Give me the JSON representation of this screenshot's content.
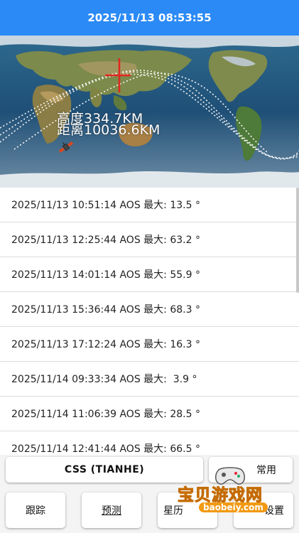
{
  "header": {
    "datetime": "2025/11/13 08:53:55"
  },
  "map": {
    "altitude": "高度334.7KM",
    "distance": "距离10036.6KM",
    "satellite_icon": "satellite-icon",
    "location_marker": "crosshair-icon"
  },
  "passes": [
    {
      "text": "2025/11/13 10:51:14 AOS 最大: 13.5 °"
    },
    {
      "text": "2025/11/13 12:25:44 AOS 最大: 63.2 °"
    },
    {
      "text": "2025/11/13 14:01:14 AOS 最大: 55.9 °"
    },
    {
      "text": "2025/11/13 15:36:44 AOS 最大: 68.3 °"
    },
    {
      "text": "2025/11/13 17:12:24 AOS 最大: 16.3 °"
    },
    {
      "text": "2025/11/14 09:33:34 AOS 最大:  3.9 °"
    },
    {
      "text": "2025/11/14 11:06:39 AOS 最大: 28.5 °"
    },
    {
      "text": "2025/11/14 12:41:44 AOS 最大: 66.5 °"
    }
  ],
  "controls": {
    "satellite_select": "CSS (TIANHE)",
    "common": "常用",
    "track": "跟踪",
    "predict": "预测",
    "ephemeris": "星历",
    "settings": "设置"
  },
  "watermark": {
    "text": "宝贝游戏网",
    "url": "baobeiy.com"
  },
  "colors": {
    "header": "#2b8af5",
    "accent": "#f6a516"
  }
}
